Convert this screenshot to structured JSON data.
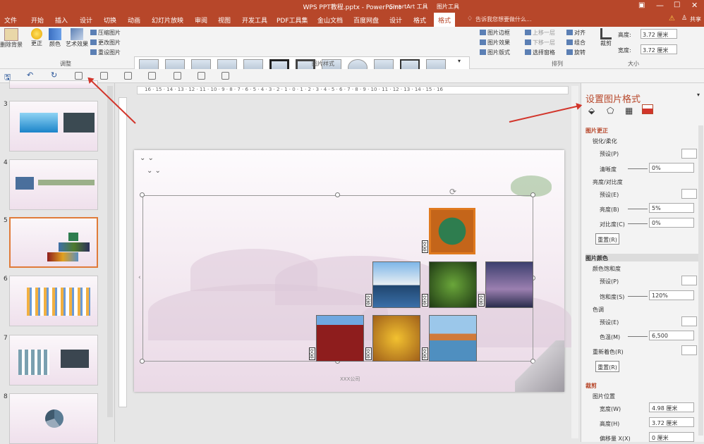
{
  "window": {
    "title": "WPS PPT教程.pptx - PowerPoint"
  },
  "context_tabs": {
    "smartart": "SmartArt 工具",
    "picture": "图片工具"
  },
  "tabs": [
    "文件",
    "开始",
    "插入",
    "设计",
    "切换",
    "动画",
    "幻灯片放映",
    "审阅",
    "视图",
    "开发工具",
    "PDF工具集",
    "金山文档",
    "百度网盘",
    "设计",
    "格式",
    "格式"
  ],
  "tell_me": "告诉我您想要做什么...",
  "share": "共享",
  "ribbon": {
    "remove_bg": "删除背景",
    "correct": "更正",
    "color": "颜色",
    "art": "艺术效果",
    "compress": "压缩图片",
    "change": "更改图片",
    "reset": "重设图片",
    "adjust_group": "调整",
    "styles_group": "图片样式",
    "border": "图片边框",
    "effects": "图片效果",
    "layout": "图片版式",
    "forward": "上移一层",
    "backward": "下移一层",
    "selection": "选择窗格",
    "align": "对齐",
    "group": "组合",
    "rotate": "旋转",
    "arrange_group": "排列",
    "crop": "裁剪",
    "height_label": "高度:",
    "height_value": "3.72 厘米",
    "width_label": "宽度:",
    "width_value": "3.72 厘米",
    "size_group": "大小"
  },
  "slides": [
    {
      "num": "3"
    },
    {
      "num": "4"
    },
    {
      "num": "5"
    },
    {
      "num": "6"
    },
    {
      "num": "7"
    },
    {
      "num": "8"
    }
  ],
  "slide": {
    "footer": "XXX公司",
    "placeholder": "文本"
  },
  "ruler": "16 · 15 · 14 · 13 · 12 · 11 · 10 · 9 · 8 · 7 · 6 · 5 · 4 · 3 · 2 · 1 · 0 · 1 · 2 · 3 · 4 · 5 · 6 · 7 · 8 · 9 · 10 · 11 · 12 · 13 · 14 · 15 · 16",
  "pane": {
    "title": "设置图片格式",
    "sections": {
      "correction": "图片更正",
      "sharpen_soften": "锐化/柔化",
      "preset": "预设(P)",
      "sharpness": "清晰度",
      "sharpness_value": "0%",
      "brightness_contrast": "亮度/对比度",
      "preset_e": "预设(E)",
      "brightness": "亮度(B)",
      "brightness_value": "5%",
      "contrast": "对比度(C)",
      "contrast_value": "0%",
      "reset": "重置(R)",
      "pic_color": "图片颜色",
      "saturation_group": "颜色饱和度",
      "saturation": "饱和度(S)",
      "saturation_value": "120%",
      "tone": "色调",
      "temperature": "色温(M)",
      "temperature_value": "6,500",
      "recolor": "重新着色(R)",
      "crop": "裁剪",
      "pic_position": "图片位置",
      "width": "宽度(W)",
      "width_value": "4.98 厘米",
      "height": "高度(H)",
      "height_value": "3.72 厘米",
      "offset_x": "偏移量 X(X)",
      "offset_x_value": "0 厘米"
    }
  },
  "colors": {
    "accent": "#b7472a",
    "annotation": "#d2352b"
  }
}
